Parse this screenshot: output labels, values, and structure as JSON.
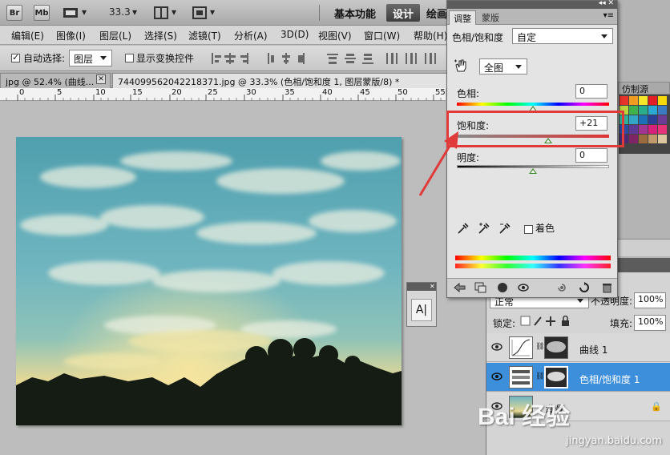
{
  "appbar": {
    "br": "Br",
    "mb": "Mb",
    "zoom": "33.3",
    "workspaces": [
      "基本功能",
      "设计",
      "绘画"
    ]
  },
  "menubar": {
    "items": [
      "编辑(E)",
      "图像(I)",
      "图层(L)",
      "选择(S)",
      "滤镜(T)",
      "分析(A)",
      "3D(D)",
      "视图(V)",
      "窗口(W)",
      "帮助(H)"
    ]
  },
  "options": {
    "auto_select_label": "自动选择:",
    "auto_select_value": "图层",
    "show_transform_label": "显示变换控件"
  },
  "tabs": {
    "tab1": "jpg @ 52.4% (曲线...",
    "tab2": "744099562042218371.jpg @ 33.3% (色相/饱和度 1, 图层蒙版/8) *"
  },
  "ruler": {
    "ticks": [
      "0",
      "5",
      "10",
      "15",
      "20",
      "25",
      "30",
      "35",
      "40",
      "45",
      "50",
      "55"
    ]
  },
  "adjustments": {
    "tab_adjust": "调整",
    "tab_mask": "蒙版",
    "title": "色相/饱和度",
    "preset": "自定",
    "channel": "全图",
    "hue_label": "色相:",
    "hue_value": "0",
    "saturation_label": "饱和度:",
    "saturation_value": "+21",
    "lightness_label": "明度:",
    "lightness_value": "0",
    "colorize_label": "着色",
    "hue_pos": 0.5,
    "saturation_pos": 0.6,
    "lightness_pos": 0.5
  },
  "right_panel": {
    "source_tab": "仿制源"
  },
  "layers": {
    "blend_mode": "正常",
    "opacity_label": "不透明度:",
    "opacity_value": "100%",
    "lock_label": "锁定:",
    "fill_label": "填充:",
    "fill_value": "100%",
    "items": [
      {
        "name": "曲线 1",
        "selected": false
      },
      {
        "name": "色相/饱和度 1",
        "selected": true
      },
      {
        "name": "背景",
        "selected": false
      }
    ]
  },
  "watermark": {
    "brand": "Bai 经验",
    "url": "jingyan.baidu.com"
  },
  "colors": {
    "highlight": "#e03a3a",
    "selected_layer": "#3d8fdb",
    "arrow": "#e03a3a"
  }
}
